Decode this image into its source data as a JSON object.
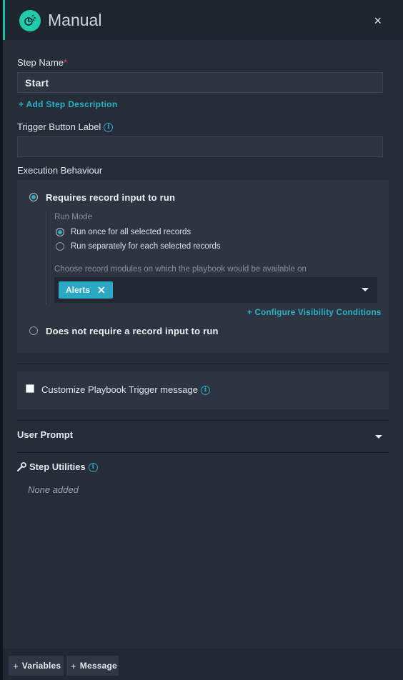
{
  "header": {
    "title": "Manual",
    "icon": "trigger-hand-icon",
    "close_label": "×"
  },
  "step_name": {
    "label": "Step Name",
    "required_mark": "*",
    "value": "Start"
  },
  "add_description_link": "+ Add Step Description",
  "trigger_button": {
    "label": "Trigger Button Label",
    "value": "",
    "placeholder": ""
  },
  "execution": {
    "label": "Execution Behaviour",
    "option_requires": "Requires record input to run",
    "run_mode_label": "Run Mode",
    "run_once": "Run once for all selected records",
    "run_separately": "Run separately for each selected records",
    "modules_label": "Choose record modules on which the playbook would be available on",
    "selected_module": "Alerts",
    "configure_link": "+ Configure Visibility Conditions",
    "option_not_requires": "Does not require a record input to run",
    "selected_option": "requires",
    "selected_run_mode": "once"
  },
  "customize": {
    "label": "Customize Playbook Trigger message",
    "checked": false
  },
  "user_prompt": {
    "label": "User Prompt"
  },
  "step_utilities": {
    "label": "Step Utilities",
    "empty_text": "None added"
  },
  "footer": {
    "variables_label": "Variables",
    "message_label": "Message"
  },
  "colors": {
    "accent": "#1bbf9f",
    "link": "#2bb3c7",
    "tag": "#2aa8c4",
    "panel": "#262d39"
  }
}
